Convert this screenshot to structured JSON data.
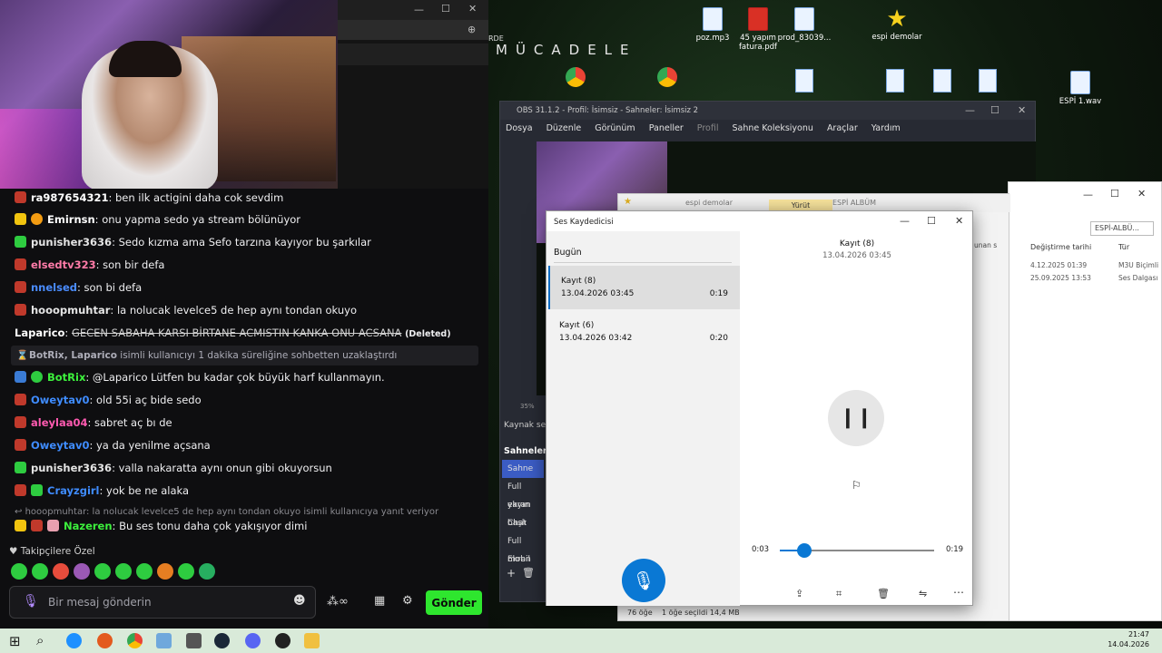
{
  "webcam": {},
  "chat": {
    "messages": [
      {
        "user": "ra987654321",
        "text": "ben ilk actigini daha cok sevdim",
        "color": "#ff4a4a"
      },
      {
        "user": "Emirnsn",
        "text": "onu yapma sedo ya stream bölünüyor",
        "color": "#ffffff"
      },
      {
        "user": "punisher3636",
        "text": "Sedo kızma ama Sefo tarzına kayıyor bu şarkılar",
        "color": "#e4e4e4"
      },
      {
        "user": "elsedtv323",
        "text": "son bir defa",
        "color": "#ff7ba8"
      },
      {
        "user": "nnelsed",
        "text": "son bi defa",
        "color": "#4a8cff"
      },
      {
        "user": "hooopmuhtar",
        "text": "la nolucak levelce5 de hep aynı tondan okuyo",
        "color": "#e4e4e4"
      },
      {
        "user": "Laparico",
        "text": "GECEN SABAHA KARSI BİRTANE ACMISTIN KANKA ONU ACSANA",
        "deleted": "(Deleted)",
        "color": "#ffffff"
      },
      {
        "user": "BotRix",
        "text": "@Laparico Lütfen bu kadar çok büyük harf kullanmayın.",
        "color": "#3cf03c"
      },
      {
        "user": "Oweytav0",
        "text": "old 55i aç bide sedo",
        "color": "#3f8cff"
      },
      {
        "user": "aleylaa04",
        "text": "sabret aç bı de",
        "color": "#ff5ab0"
      },
      {
        "user": "Oweytav0",
        "text": "ya da yenilme açsana",
        "color": "#3f8cff"
      },
      {
        "user": "punisher3636",
        "text": "valla nakaratta aynı onun gibi okuyorsun",
        "color": "#e4e4e4"
      },
      {
        "user": "Crayzgirl",
        "text": "yok be ne alaka",
        "color": "#3f8cff"
      },
      {
        "user": "Nazeren",
        "text": "Bu ses tonu daha çok yakışıyor dimi",
        "color": "#3cf03c"
      }
    ],
    "system_message": {
      "users": "BotRix, Laparico",
      "text": "isimli kullanıcıyı 1 dakika süreliğine sohbetten uzaklaştırdı"
    },
    "reply_preview": "hooopmuhtar: la nolucak levelce5 de hep aynı tondan okuyo isimli kullanıcıya yanıt veriyor",
    "followers_label": "Takipçilere Özel",
    "input_placeholder": "Bir mesaj gönderin",
    "send_label": "Gönder"
  },
  "desktop": {
    "brand_text": "MÜCADELE",
    "icons": [
      {
        "label": "poz.mp3"
      },
      {
        "label": "45 yapım fatura.pdf"
      },
      {
        "label": "prod_83039..."
      },
      {
        "label": "espi demolar"
      },
      {
        "label": "ESPİ 1.wav"
      },
      {
        "label": "RDE"
      }
    ]
  },
  "obs": {
    "title": "OBS 31.1.2 - Profil: İsimsiz - Sahneler: İsimsiz 2",
    "menu": [
      "Dosya",
      "Düzenle",
      "Görünüm",
      "Paneller",
      "Profil",
      "Sahne Koleksiyonu",
      "Araçlar",
      "Yardım"
    ],
    "sources_label": "Kaynak seç",
    "scenes_label": "Sahneler",
    "scenes": [
      "Sahne",
      "Full ekran",
      "yayın başlı",
      "Chat",
      "Full Ekran",
      "mobil"
    ],
    "zoom": "35%"
  },
  "explorer": {
    "path_label": "espi demolar",
    "play_label": "Yürüt",
    "breadcrumb": "ESPİ ALBÜM",
    "search_placeholder": "ESPİ-ALBÜ...",
    "col_date": "Değiştirme tarihi",
    "col_type": "Tür",
    "rows": [
      {
        "date": "4.12.2025 01:39",
        "type": "M3U Biçimli"
      },
      {
        "date": "25.09.2025 13:53",
        "type": "Ses Dalgası"
      }
    ],
    "status_count": "76 öğe",
    "status_selected": "1 öğe seçildi  14,4 MB",
    "side_text": "unan s"
  },
  "recorder": {
    "title": "Ses Kaydedicisi",
    "section": "Bugün",
    "recordings": [
      {
        "name": "Kayıt (8)",
        "date": "13.04.2026 03:45",
        "duration": "0:19"
      },
      {
        "name": "Kayıt (6)",
        "date": "13.04.2026 03:42",
        "duration": "0:20"
      }
    ],
    "current_name": "Kayıt (8)",
    "current_date": "13.04.2026 03:45",
    "time_current": "0:03",
    "time_total": "0:19",
    "progress": 0.16
  },
  "taskbar": {
    "time": "21:47",
    "date": "14.04.2026"
  }
}
